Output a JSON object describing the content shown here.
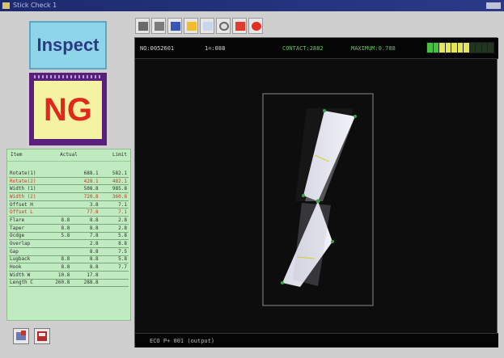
{
  "window": {
    "title": "Stick Check 1"
  },
  "left": {
    "inspect_label": "Inspect",
    "result_label": "NG",
    "table": {
      "headers": [
        "Item",
        "Actual",
        "Limit"
      ],
      "rows": [
        {
          "name": "Rotate(1)",
          "v1": "",
          "v2": "688.1",
          "v3": "582.1",
          "status": "normal"
        },
        {
          "name": "Rotate(2)",
          "v1": "",
          "v2": "428.1",
          "v3": "482.1",
          "status": "red"
        },
        {
          "name": "Width (1)",
          "v1": "",
          "v2": "508.8",
          "v3": "985.8",
          "status": "normal"
        },
        {
          "name": "Width (2)",
          "v1": "",
          "v2": "720.8",
          "v3": "360.8",
          "status": "red"
        },
        {
          "name": "Offset H",
          "v1": "",
          "v2": "3.8",
          "v3": "7.1",
          "status": "normal"
        },
        {
          "name": "Offset L",
          "v1": "",
          "v2": "77.8",
          "v3": "7.1",
          "status": "red"
        },
        {
          "name": "Flare",
          "v1": "8.8",
          "v2": "8.8",
          "v3": "2.8",
          "status": "normal"
        },
        {
          "name": "Taper",
          "v1": "8.8",
          "v2": "8.8",
          "v3": "2.8",
          "status": "normal"
        },
        {
          "name": "Ocdge",
          "v1": "5.8",
          "v2": "7.8",
          "v3": "5.8",
          "status": "normal"
        },
        {
          "name": "Overlap",
          "v1": "",
          "v2": "2.8",
          "v3": "8.8",
          "status": "normal"
        },
        {
          "name": "Gap",
          "v1": "",
          "v2": "8.8",
          "v3": "7.5",
          "status": "normal"
        },
        {
          "name": "Lugback",
          "v1": "8.8",
          "v2": "8.8",
          "v3": "5.8",
          "status": "normal"
        },
        {
          "name": "Hook",
          "v1": "8.8",
          "v2": "8.8",
          "v3": "7.7",
          "status": "normal"
        },
        {
          "name": "Width W",
          "v1": "10.8",
          "v2": "17.8",
          "v3": "",
          "status": "normal"
        },
        {
          "name": "Length C",
          "v1": "260.8",
          "v2": "288.8",
          "v3": "",
          "status": "normal"
        }
      ]
    }
  },
  "toolbar": {
    "buttons": [
      {
        "name": "camera-button"
      },
      {
        "name": "film-button"
      },
      {
        "name": "save-button"
      },
      {
        "name": "sun-button"
      },
      {
        "name": "image-button"
      },
      {
        "name": "zoom-button"
      },
      {
        "name": "report-button"
      },
      {
        "name": "stop-button"
      }
    ]
  },
  "viewer": {
    "status_top": {
      "code": "NO:0052601",
      "count": "1=:088",
      "contact": "CONTACT:2882",
      "max": "MAXIMUM:0.788"
    },
    "meter": [
      "on-g",
      "on-g",
      "on-y",
      "on-y",
      "on-y",
      "on-y",
      "on-y",
      "off",
      "off",
      "off",
      "off"
    ],
    "status_bottom": "ECO P+ 001 (output)"
  },
  "colors": {
    "inspect_bg": "#8fd5ea",
    "ng_bg": "#5a1f7d",
    "ng_text": "#e0291c",
    "table_bg": "#c0ebc0"
  }
}
